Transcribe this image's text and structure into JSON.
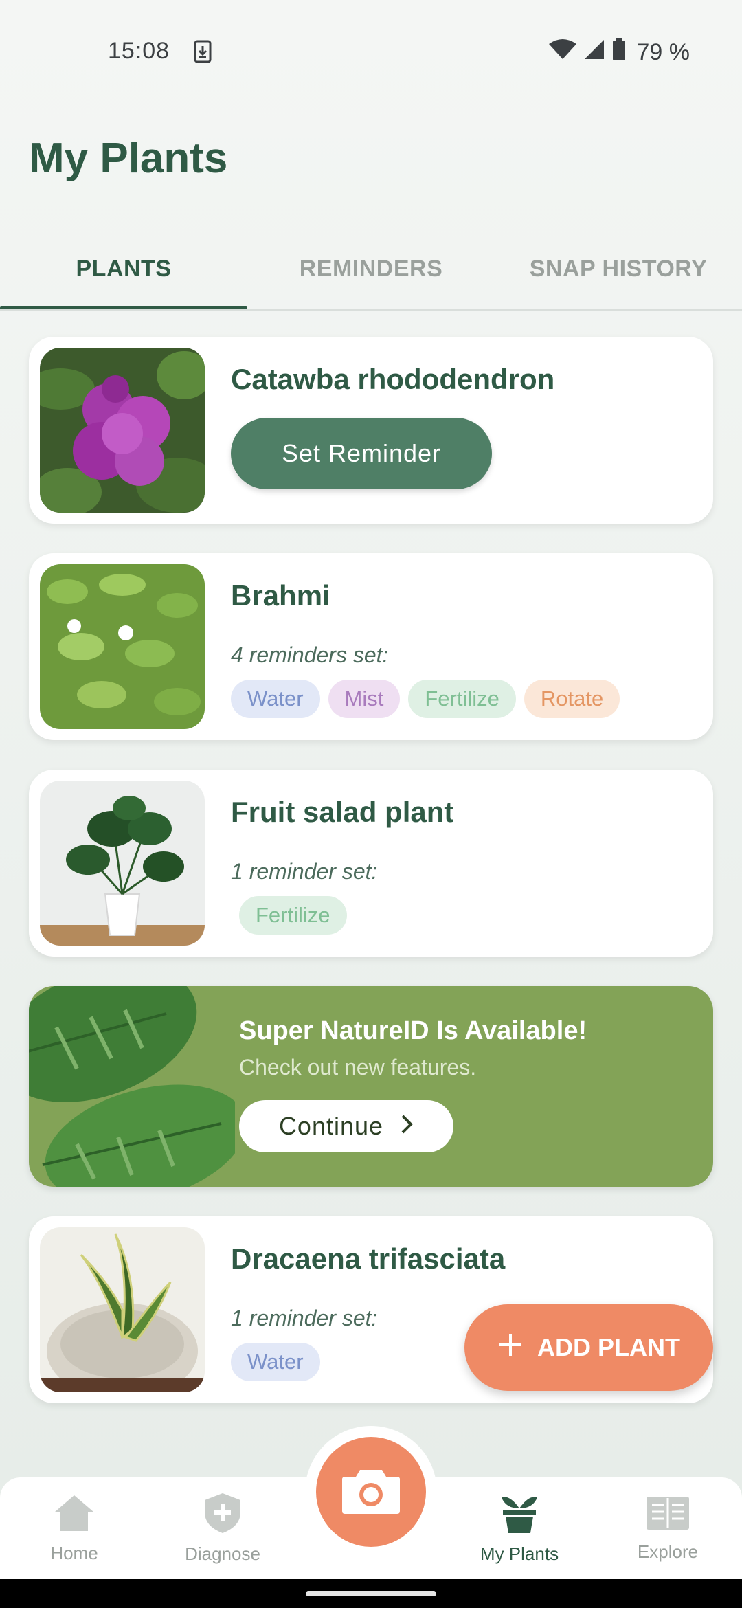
{
  "status_bar": {
    "time": "15:08",
    "battery": "79 %"
  },
  "page": {
    "title": "My Plants"
  },
  "tabs": [
    {
      "label": "PLANTS",
      "active": true
    },
    {
      "label": "REMINDERS",
      "active": false
    },
    {
      "label": "SNAP HISTORY",
      "active": false
    }
  ],
  "plants": [
    {
      "name": "Catawba rhododendron",
      "action_label": "Set Reminder"
    },
    {
      "name": "Brahmi",
      "reminder_text": "4 reminders set:",
      "chips": [
        "Water",
        "Mist",
        "Fertilize",
        "Rotate"
      ]
    },
    {
      "name": "Fruit salad plant",
      "reminder_text": "1 reminder set:",
      "chips": [
        "Fertilize"
      ]
    },
    {
      "name": "Dracaena trifasciata",
      "reminder_text": "1 reminder set:",
      "chips": [
        "Water"
      ]
    }
  ],
  "promo": {
    "title": "Super NatureID Is Available!",
    "subtitle": "Check out new features.",
    "button_label": "Continue"
  },
  "fab": {
    "label": "ADD PLANT"
  },
  "bottom_nav": [
    {
      "label": "Home",
      "icon": "home-icon"
    },
    {
      "label": "Diagnose",
      "icon": "shield-plus-icon"
    },
    {
      "label": "My Plants",
      "icon": "plant-pot-icon",
      "active": true
    },
    {
      "label": "Explore",
      "icon": "book-icon"
    }
  ],
  "colors": {
    "primary": "#2f5a45",
    "accent": "#ef8a65",
    "promo_bg": "#83a357",
    "button_green": "#4f7f66"
  }
}
